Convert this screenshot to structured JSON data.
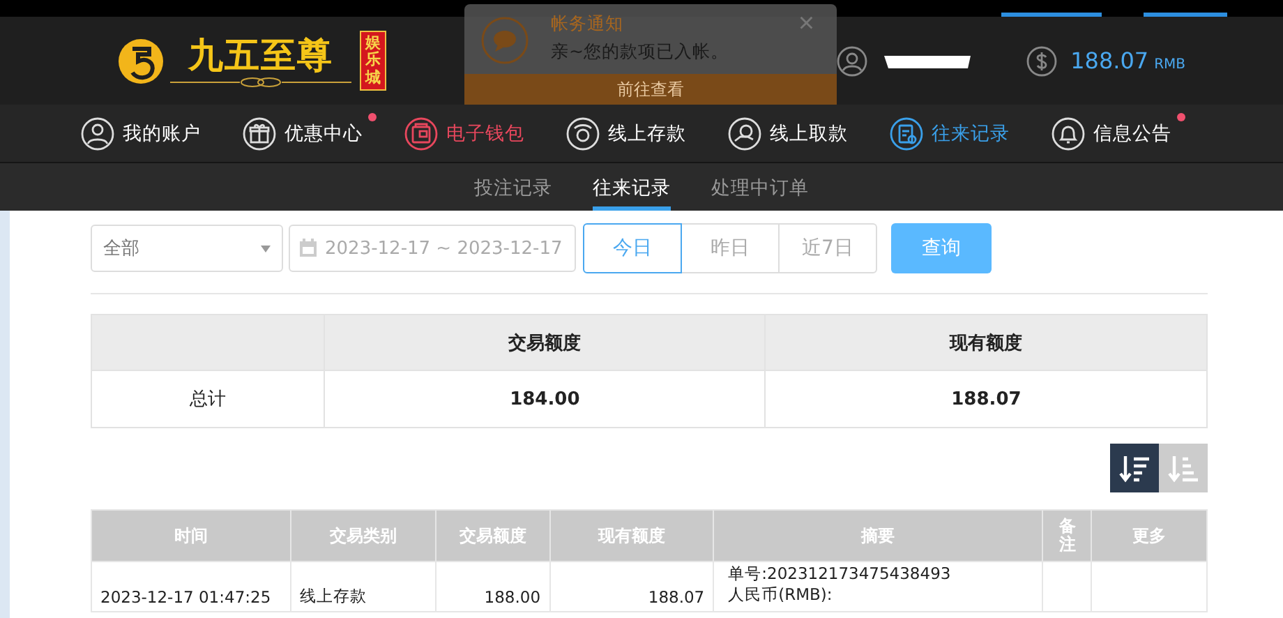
{
  "logo": {
    "name": "九五至尊",
    "tag": "娱乐城"
  },
  "notification": {
    "title": "帐务通知",
    "message": "亲~您的款项已入帐。",
    "close": "×",
    "action": "前往查看"
  },
  "account": {
    "balance": "188.07",
    "currency": "RMB"
  },
  "nav": [
    {
      "label": "我的账户",
      "selected": false,
      "highlighted": false,
      "badge": false
    },
    {
      "label": "优惠中心",
      "selected": false,
      "highlighted": false,
      "badge": true
    },
    {
      "label": "电子钱包",
      "selected": false,
      "highlighted": true,
      "badge": false
    },
    {
      "label": "线上存款",
      "selected": false,
      "highlighted": false,
      "badge": false
    },
    {
      "label": "线上取款",
      "selected": false,
      "highlighted": false,
      "badge": false
    },
    {
      "label": "往来记录",
      "selected": true,
      "highlighted": false,
      "badge": false
    },
    {
      "label": "信息公告",
      "selected": false,
      "highlighted": false,
      "badge": true
    }
  ],
  "subtabs": [
    {
      "label": "投注记录",
      "selected": false
    },
    {
      "label": "往来记录",
      "selected": true
    },
    {
      "label": "处理中订单",
      "selected": false
    }
  ],
  "filters": {
    "type": "全部",
    "date_range": "2023-12-17 ~ 2023-12-17",
    "ranges": [
      {
        "label": "今日",
        "selected": true
      },
      {
        "label": "昨日",
        "selected": false
      },
      {
        "label": "近7日",
        "selected": false
      }
    ],
    "query": "查询"
  },
  "summary": {
    "columns": [
      "",
      "交易额度",
      "现有额度"
    ],
    "rows": [
      [
        "总计",
        "184.00",
        "188.07"
      ]
    ]
  },
  "sort": [
    {
      "selected": true
    },
    {
      "selected": false
    }
  ],
  "table": {
    "columns": [
      "时间",
      "交易类别",
      "交易额度",
      "现有额度",
      "摘要",
      "备注",
      "更多"
    ],
    "rows": [
      {
        "cells": [
          "2023-12-17 01:47:25",
          "线上存款",
          "188.00",
          "188.07"
        ],
        "summary": [
          "单号:202312173475438493",
          "人民币(RMB):"
        ]
      }
    ]
  }
}
